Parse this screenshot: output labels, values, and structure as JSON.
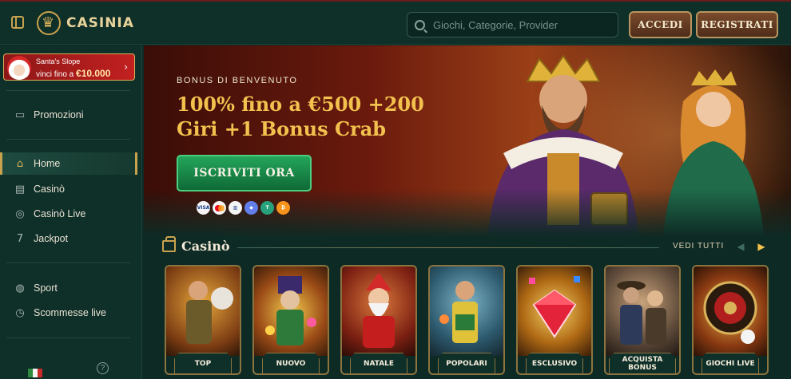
{
  "header": {
    "brand": "CASINIA",
    "search_placeholder": "Giochi, Categorie, Provider",
    "login_label": "ACCEDI",
    "register_label": "REGISTRATI"
  },
  "sidebar": {
    "promo": {
      "title": "Santa's Slope",
      "subtitle_prefix": "vinci fino a",
      "amount": "€10.000"
    },
    "items": [
      {
        "label": "Promozioni",
        "icon": "promotions-icon"
      },
      {
        "label": "Home",
        "icon": "home-icon",
        "active": true
      },
      {
        "label": "Casinò",
        "icon": "casino-icon"
      },
      {
        "label": "Casinò Live",
        "icon": "casino-live-icon"
      },
      {
        "label": "Jackpot",
        "icon": "jackpot-icon"
      },
      {
        "label": "Sport",
        "icon": "sport-icon"
      },
      {
        "label": "Scommesse live",
        "icon": "live-bets-icon"
      }
    ]
  },
  "hero": {
    "kicker": "BONUS DI BENVENUTO",
    "title_line1": "100% fino a €500 +200",
    "title_line2": "Giri +1 Bonus Crab",
    "cta_label": "ISCRIVITI ORA",
    "payments": [
      "VISA",
      "mastercard",
      "bank",
      "ethereum",
      "tether",
      "bitcoin"
    ]
  },
  "section": {
    "title": "Casinò",
    "view_all": "VEDI TUTTI"
  },
  "cards": [
    {
      "label": "TOP"
    },
    {
      "label": "NUOVO"
    },
    {
      "label": "NATALE"
    },
    {
      "label": "POPOLARI"
    },
    {
      "label": "ESCLUSIVO"
    },
    {
      "label_line1": "ACQUISTA",
      "label_line2": "BONUS"
    },
    {
      "label": "GIOCHI LIVE"
    }
  ],
  "colors": {
    "accent_gold": "#c9a24e",
    "background": "#0e2a24",
    "cta_green": "#1a8a48",
    "promo_red": "#c22020"
  }
}
